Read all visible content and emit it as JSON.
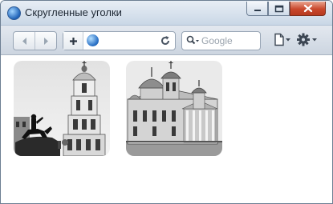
{
  "window": {
    "title": "Скругленные уголки",
    "app_icon": "browser-globe-icon"
  },
  "toolbar": {
    "search_placeholder": "Google",
    "icons": [
      "back-icon",
      "forward-icon",
      "add-tab-icon",
      "globe-icon",
      "reload-icon",
      "search-icon",
      "page-menu-icon",
      "settings-gear-icon"
    ]
  },
  "content": {
    "images": [
      {
        "id": "cathedral-bell-tower-photo",
        "description": "black-and-white photo of a bell tower with an equestrian monument"
      },
      {
        "id": "church-domes-photo",
        "description": "black-and-white photo of a domed church"
      }
    ]
  },
  "colors": {
    "titlebar": "#d6e1ed",
    "close_button": "#c9482c",
    "toolbar": "#d5dde7"
  }
}
